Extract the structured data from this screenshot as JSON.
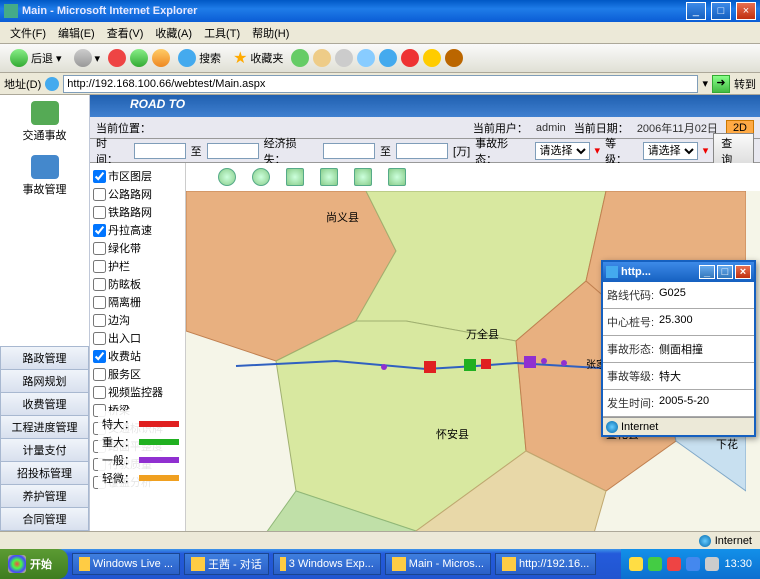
{
  "window": {
    "title": "Main - Microsoft Internet Explorer",
    "menus": [
      "文件(F)",
      "编辑(E)",
      "查看(V)",
      "收藏(A)",
      "工具(T)",
      "帮助(H)"
    ],
    "back_label": "后退",
    "search_label": "搜索",
    "fav_label": "收藏夹",
    "addr_label": "地址(D)",
    "url": "http://192.168.100.66/webtest/Main.aspx",
    "go_label": "转到"
  },
  "sidebar": {
    "top": [
      {
        "label": "交通事故"
      },
      {
        "label": "事故管理"
      }
    ],
    "menu": [
      "路政管理",
      "路网规划",
      "收费管理",
      "工程进度管理",
      "计量支付",
      "招投标管理",
      "养护管理",
      "合同管理"
    ]
  },
  "header": {
    "brand": "ROAD TO"
  },
  "infobar": {
    "pos_label": "当前位置：",
    "user_label": "当前用户：",
    "user": "admin",
    "date_label": "当前日期：",
    "date": "2006年11月02日",
    "mode": "2D"
  },
  "query": {
    "time_label": "时间：",
    "to": "至",
    "loss_label": "经济损失：",
    "unit": "[万]",
    "form_label": "事故形态：",
    "form_sel": "请选择",
    "level_label": "等级：",
    "level_sel": "请选择",
    "btn": "查  询"
  },
  "layers": [
    "市区图层",
    "公路路网",
    "铁路路网",
    "丹拉高速",
    "绿化带",
    "护栏",
    "防眩板",
    "隔离栅",
    "边沟",
    "出入口",
    "收费站",
    "服务区",
    "视频监控器",
    "桥梁",
    "交通标识牌",
    "路面平整度",
    "行驶质量",
    "覆盖分析"
  ],
  "layer_checked": [
    0,
    3,
    10
  ],
  "map_labels": {
    "a": "尚义县",
    "b": "万全县",
    "c": "怀安县",
    "d": "宣化县",
    "e": "张家口市区",
    "f": "下花"
  },
  "legend": [
    {
      "name": "特大",
      "color": "#e02020"
    },
    {
      "name": "重大",
      "color": "#20b020"
    },
    {
      "name": "一般",
      "color": "#9030d0"
    },
    {
      "name": "轻微",
      "color": "#f0a020"
    }
  ],
  "popup": {
    "title": "http...",
    "rows": [
      {
        "label": "路线代码:",
        "val": "G025"
      },
      {
        "label": "中心桩号:",
        "val": "25.300"
      },
      {
        "label": "事故形态:",
        "val": "侧面相撞"
      },
      {
        "label": "事故等级:",
        "val": "特大"
      },
      {
        "label": "发生时间:",
        "val": "2005-5-20"
      }
    ],
    "footer": "Internet"
  },
  "status": {
    "zone": "Internet"
  },
  "taskbar": {
    "start": "开始",
    "items": [
      "Windows Live ...",
      "王茜 - 对话",
      "3 Windows Exp...",
      "Main - Micros...",
      "http://192.16..."
    ],
    "time": "13:30"
  }
}
